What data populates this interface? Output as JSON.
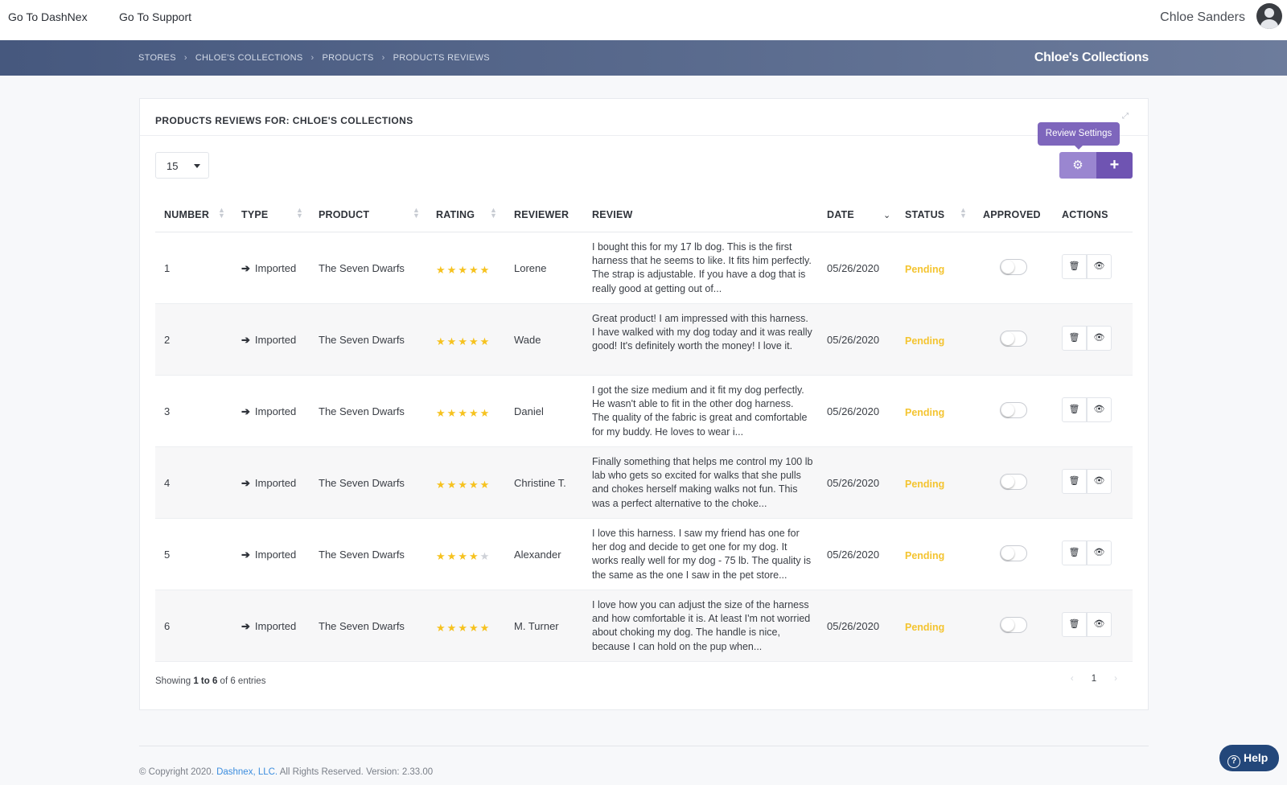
{
  "topnav": {
    "link_dashnex": "Go To DashNex",
    "link_support": "Go To Support",
    "user_name": "Chloe Sanders"
  },
  "banner": {
    "breadcrumbs": [
      "STORES",
      "CHLOE'S COLLECTIONS",
      "PRODUCTS",
      "PRODUCTS REVIEWS"
    ],
    "store_title": "Chloe's Collections"
  },
  "card": {
    "title": "PRODUCTS REVIEWS FOR: CHLOE'S COLLECTIONS",
    "page_length": "15",
    "tooltip": "Review Settings",
    "add_icon": "plus-icon",
    "settings_icon": "gear-icon"
  },
  "table": {
    "columns": [
      "NUMBER",
      "TYPE",
      "PRODUCT",
      "RATING",
      "REVIEWER",
      "REVIEW",
      "DATE",
      "STATUS",
      "APPROVED",
      "ACTIONS"
    ],
    "rows": [
      {
        "number": "1",
        "type": "Imported",
        "product": "The Seven Dwarfs",
        "rating": 5,
        "reviewer": "Lorene",
        "review": "I bought this for my 17 lb dog. This is the first harness that he seems to like. It fits him perfectly. The strap is adjustable. If you have a dog that is really good at getting out of...",
        "date": "05/26/2020",
        "status": "Pending",
        "approved": false
      },
      {
        "number": "2",
        "type": "Imported",
        "product": "The Seven Dwarfs",
        "rating": 5,
        "reviewer": "Wade",
        "review": "Great product! I am impressed with this harness. I have walked with my dog today and it was really good! It's definitely worth the money! I love it.",
        "date": "05/26/2020",
        "status": "Pending",
        "approved": false
      },
      {
        "number": "3",
        "type": "Imported",
        "product": "The Seven Dwarfs",
        "rating": 5,
        "reviewer": "Daniel",
        "review": "I got the size medium and it fit my dog perfectly. He wasn't able to fit in the other dog harness. The quality of the fabric is great and comfortable for my buddy. He loves to wear i...",
        "date": "05/26/2020",
        "status": "Pending",
        "approved": false
      },
      {
        "number": "4",
        "type": "Imported",
        "product": "The Seven Dwarfs",
        "rating": 5,
        "reviewer": "Christine T.",
        "review": "Finally something that helps me control my 100 lb lab who gets so excited for walks that she pulls and chokes herself making walks not fun. This was a perfect alternative to the choke...",
        "date": "05/26/2020",
        "status": "Pending",
        "approved": false
      },
      {
        "number": "5",
        "type": "Imported",
        "product": "The Seven Dwarfs",
        "rating": 4,
        "reviewer": "Alexander",
        "review": "I love this harness. I saw my friend has one for her dog and decide to get one for my dog. It works really well for my dog - 75 lb. The quality is the same as the one I saw in the pet store...",
        "date": "05/26/2020",
        "status": "Pending",
        "approved": false
      },
      {
        "number": "6",
        "type": "Imported",
        "product": "The Seven Dwarfs",
        "rating": 5,
        "reviewer": "M. Turner",
        "review": "I love how you can adjust the size of the harness and how comfortable it is. At least I'm not worried about choking my dog. The handle is nice, because I can hold on the pup when...",
        "date": "05/26/2020",
        "status": "Pending",
        "approved": false
      }
    ]
  },
  "pagination": {
    "showing_prefix": "Showing ",
    "showing_range": "1 to 6",
    "showing_suffix": " of 6 entries",
    "prev": "‹",
    "current_page": "1",
    "next": "›"
  },
  "footer": {
    "copyright": "© Copyright 2020. ",
    "brand": "Dashnex, LLC.",
    "rights": " All Rights Reserved. Version: 2.33.00"
  },
  "help": {
    "label": "Help"
  },
  "colors": {
    "accent": "#6f54b2",
    "status_pending": "#f4c430",
    "banner": "#46587e",
    "star": "#f6c21f"
  }
}
